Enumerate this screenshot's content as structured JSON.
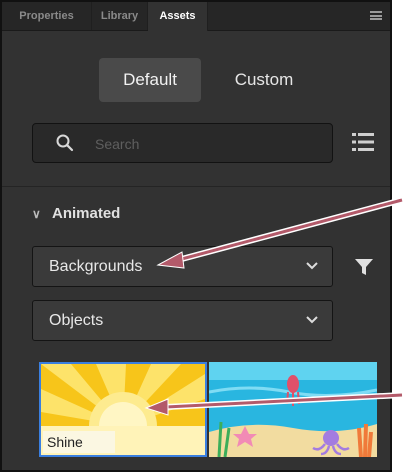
{
  "tabs": [
    {
      "label": "Properties",
      "active": false
    },
    {
      "label": "Library",
      "active": false
    },
    {
      "label": "Assets",
      "active": true
    }
  ],
  "panel_menu_icon": "hamburger-menu-icon",
  "segment": {
    "default": "Default",
    "custom": "Custom",
    "selected": "Default"
  },
  "search": {
    "placeholder": "Search",
    "value": ""
  },
  "section": {
    "title": "Animated",
    "expanded": true
  },
  "dropdowns": {
    "category": "Backgrounds",
    "subcategory": "Objects"
  },
  "assets": [
    {
      "label": "Shine",
      "selected": true
    },
    {
      "label": "",
      "selected": false
    }
  ],
  "colors": {
    "panel": "#323232",
    "tabbar": "#262626",
    "selection": "#3a7fe0",
    "annotation_arrow": "#b35a6a"
  }
}
